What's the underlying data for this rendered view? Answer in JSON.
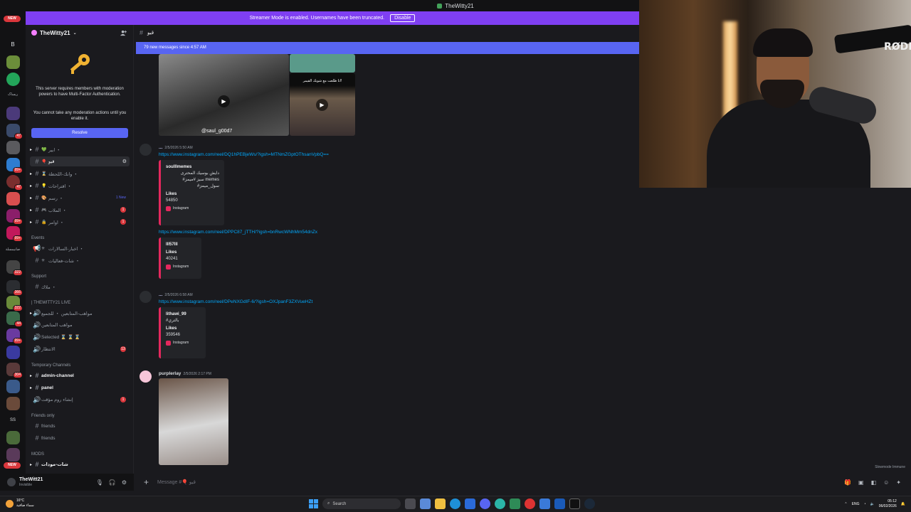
{
  "window_title": "TheWitty21",
  "streamer_banner": {
    "text": "Streamer Mode is enabled. Usernames have been truncated.",
    "disable_label": "Disable"
  },
  "rail": {
    "new_label": "NEW",
    "letter_b": "B",
    "text_1": "ریساک",
    "text_2": "ساوي",
    "text_3": "صانيمسلة",
    "letter_ss": "SS",
    "badges": [
      "47",
      "99+",
      "47",
      "99+",
      "99+",
      "322",
      "366",
      "322",
      "44",
      "99+",
      "304"
    ]
  },
  "guild": {
    "name": "TheWitty21"
  },
  "mfa_notice": {
    "line1": "This server requires members with moderation powers to have Multi-Factor Authentication.",
    "line2": "You cannot take any moderation actions until you enable it.",
    "resolve_label": "Resolve"
  },
  "channels": [
    {
      "name": "ابير ・",
      "emoji": "💚"
    },
    {
      "name": "قيو",
      "emoji": "🎈"
    },
    {
      "name": "وانك-اللحظة ・",
      "emoji": "⌛"
    },
    {
      "name": "اقتراحات ・",
      "emoji": "💡"
    },
    {
      "name": "رسم ・",
      "emoji": "🎨",
      "tag": "1 New"
    },
    {
      "name": "الملاب ・",
      "emoji": "🎮",
      "badge": "1"
    },
    {
      "name": "اوامر ・",
      "emoji": "🔒",
      "badge": "1"
    }
  ],
  "categories": {
    "events": "Events",
    "support": "Support",
    "live": "| THEWITTY21 LIVE",
    "temp": "Temporary Channels",
    "friends": "Friends only",
    "mods": "MODS"
  },
  "event_channels": [
    {
      "name": "اخبار-السالارات ・"
    },
    {
      "name": "شات-فعاليات ・"
    }
  ],
  "support_channels": [
    {
      "name": "ملاك ・"
    }
  ],
  "live_channels": [
    {
      "name": "مواهب-المتابعين ・ للجميع"
    },
    {
      "name": "مواهب المتابعين"
    },
    {
      "name": "Selected ⌛ ⌛ ⌛"
    },
    {
      "name": "الانتظار",
      "badge": "13"
    }
  ],
  "temp_channels": [
    {
      "name": "admin-channel"
    },
    {
      "name": "panel"
    },
    {
      "name": "إنشاء روم مؤقت",
      "badge": "1"
    }
  ],
  "friends_channels": [
    {
      "name": "friends"
    },
    {
      "name": "friends"
    }
  ],
  "mods_channels": [
    {
      "name": "شات-مودات"
    }
  ],
  "user": {
    "name": "TheWitt21",
    "status": "Invisible"
  },
  "channel_header": {
    "name": "قيو"
  },
  "new_messages_bar": "79 new messages since 4:57 AM",
  "attachment_caption": "@saul_g00d7",
  "attachment_caption2": "انا طلعت مع شوبك القيمر!",
  "messages": [
    {
      "time": "2/5/2026 5:50 AM",
      "author": "...",
      "link": "https://www.instagram.com/reel/DQ1hPEBjeWs/?igsh=MTNmZGptOThsanVpbQ==",
      "embed": {
        "author": "soulllmemes",
        "desc1": "دايش بوسيك المحترى",
        "desc2": "#سيز #ميمز memes #سول_ميمز",
        "field": "Likes",
        "value": "54850",
        "footer": "Instagram"
      },
      "link2": "https://www.instagram.com/reel/DPPC87_jTTH/?igsh=bnRwcWNhMm54dnZx",
      "embed2": {
        "author": "lll57lll",
        "field": "Likes",
        "value": "40241",
        "footer": "Instagram"
      }
    },
    {
      "time": "2/5/2026 6:58 AM",
      "author": "...",
      "link": "https://www.instagram.com/reel/DPeNXGdIF-6/?igsh=OXJpanF3ZXVueHZt",
      "embed": {
        "author": "lithawi_99",
        "desc1": "#بالتري",
        "field": "Likes",
        "value": "359546",
        "footer": "Instagram"
      }
    },
    {
      "time": "2/5/2026 2:17 PM",
      "author": "purplerlay"
    }
  ],
  "composer": {
    "placeholder": "Message #🎈 قيو"
  },
  "slowmode": "Slowmode Immune",
  "cam_brand": "RØDE",
  "taskbar": {
    "weather_temp": "16°C",
    "weather_desc": "سماء صافية",
    "search_label": "Search",
    "lang": "ENG",
    "time": "05:12",
    "date": "06/02/2026"
  },
  "colors": {
    "accent": "#5865f2",
    "streamer": "#7f3ff2",
    "link": "#00a8fc",
    "badge": "#da373c",
    "instagram": "#e4285d"
  }
}
